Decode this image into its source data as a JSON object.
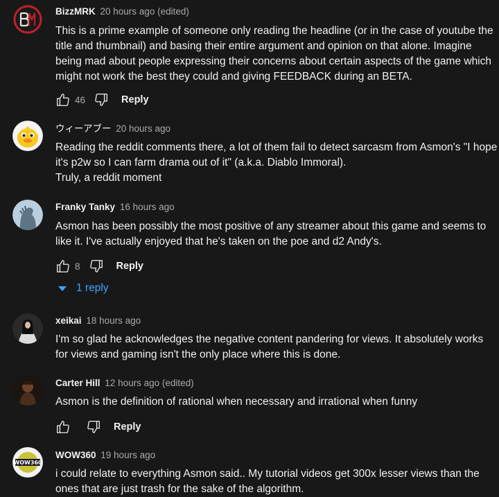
{
  "comments": [
    {
      "author": "BizzMRK",
      "time": "20 hours ago (edited)",
      "text": "This is a prime example of someone only reading the headline (or in the case of youtube the title and thumbnail) and basing their entire argument and opinion on that alone. Imagine being mad about people expressing their concerns about certain aspects of the game which might not work the best they could and giving FEEDBACK during an BETA.",
      "likes": "46",
      "reply_label": "Reply"
    },
    {
      "author": "ウィーアブー",
      "time": "20 hours ago",
      "text": "Reading the reddit comments there, a lot of them fail to detect sarcasm from Asmon's \"I hope it's p2w so I can farm drama out of it\" (a.k.a. Diablo Immoral).\nTruly, a reddit moment"
    },
    {
      "author": "Franky Tanky",
      "time": "16 hours ago",
      "text": "Asmon has been possibly the most positive of any streamer about this game and seems to like it.  I've actually enjoyed that he's taken on the poe and d2 Andy's.",
      "likes": "8",
      "reply_label": "Reply",
      "replies_label": "1 reply"
    },
    {
      "author": "xeikai",
      "time": "18 hours ago",
      "text": "I'm so glad he acknowledges the negative content pandering for views.  It absolutely works for views and gaming isn't the only place where this is done."
    },
    {
      "author": "Carter Hill",
      "time": "12 hours ago (edited)",
      "text": "Asmon is the definition of rational when necessary and irrational when funny",
      "reply_label": "Reply"
    },
    {
      "author": "WOW360",
      "time": "19 hours ago",
      "text": "i could relate to everything Asmon said.. My tutorial videos get 300x lesser views than the ones that are just trash for the sake of the algorithm.",
      "avatar_text": "WOW360"
    }
  ],
  "colors": {
    "background": "#181818",
    "text": "#f1f1f1",
    "secondary": "#aaaaaa",
    "link": "#3ea6ff"
  }
}
